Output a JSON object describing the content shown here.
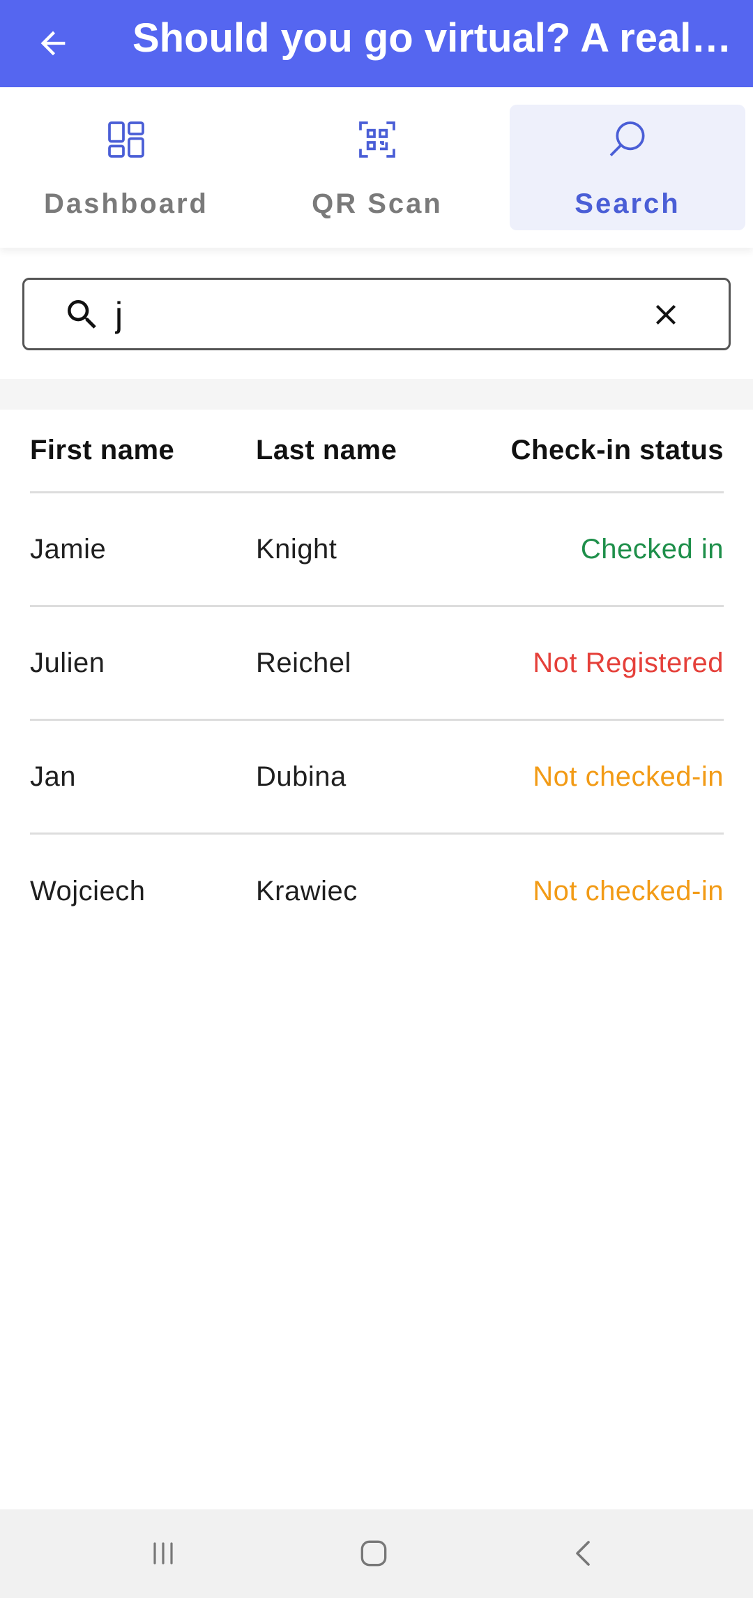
{
  "appbar": {
    "title": "Should you go virtual? A reality check",
    "bg_color": "#5566f0",
    "back_icon": "arrow-left-icon"
  },
  "tabs": [
    {
      "label": "Dashboard",
      "icon": "dashboard-grid-icon",
      "active": false
    },
    {
      "label": "QR Scan",
      "icon": "qr-code-icon",
      "active": false
    },
    {
      "label": "Search",
      "icon": "search-icon",
      "active": true
    }
  ],
  "search": {
    "value": "j",
    "placeholder": "",
    "clear_icon": "close-icon"
  },
  "table": {
    "headers": [
      "First name",
      "Last name",
      "Check-in status"
    ],
    "rows": [
      {
        "first": "Jamie",
        "last": "Knight",
        "status": "Checked in",
        "status_color": "#1e8f4a"
      },
      {
        "first": "Julien",
        "last": "Reichel",
        "status": "Not Registered",
        "status_color": "#e5403a"
      },
      {
        "first": "Jan",
        "last": "Dubina",
        "status": "Not checked-in",
        "status_color": "#f29b16"
      },
      {
        "first": "Wojciech",
        "last": "Krawiec",
        "status": "Not checked-in",
        "status_color": "#f29b16"
      }
    ]
  },
  "colors": {
    "accent": "#5566f0",
    "active_tab_bg": "#eef0fb",
    "active_tab_text": "#4a5ed6"
  },
  "system_nav": [
    "recent-apps-icon",
    "home-icon",
    "back-chevron-icon"
  ]
}
